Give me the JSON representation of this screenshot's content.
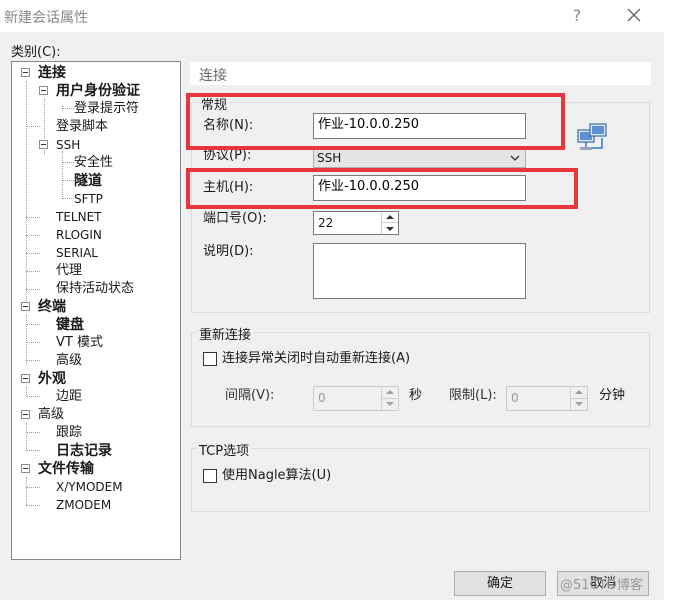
{
  "window": {
    "title": "新建会话属性",
    "help": "?"
  },
  "sidebar": {
    "category_label": "类别(C):",
    "items": [
      {
        "label": "连接"
      },
      {
        "label": "用户身份验证"
      },
      {
        "label": "登录提示符"
      },
      {
        "label": "登录脚本"
      },
      {
        "label": "SSH"
      },
      {
        "label": "安全性"
      },
      {
        "label": "隧道"
      },
      {
        "label": "SFTP"
      },
      {
        "label": "TELNET"
      },
      {
        "label": "RLOGIN"
      },
      {
        "label": "SERIAL"
      },
      {
        "label": "代理"
      },
      {
        "label": "保持活动状态"
      },
      {
        "label": "终端"
      },
      {
        "label": "键盘"
      },
      {
        "label": "VT 模式"
      },
      {
        "label": "高级"
      },
      {
        "label": "外观"
      },
      {
        "label": "边距"
      },
      {
        "label": "高级"
      },
      {
        "label": "跟踪"
      },
      {
        "label": "日志记录"
      },
      {
        "label": "文件传输"
      },
      {
        "label": "X/YMODEM"
      },
      {
        "label": "ZMODEM"
      }
    ]
  },
  "main": {
    "section_title": "连接",
    "general": {
      "group_label": "常规",
      "name_label": "名称(N):",
      "name_value": "作业-10.0.0.250",
      "protocol_label": "协议(P):",
      "protocol_value": "SSH",
      "host_label": "主机(H):",
      "host_value": "作业-10.0.0.250",
      "port_label": "端口号(O):",
      "port_value": "22",
      "desc_label": "说明(D):",
      "desc_value": ""
    },
    "reconnect": {
      "group_label": "重新连接",
      "checkbox_label": "连接异常关闭时自动重新连接(A)",
      "interval_label": "间隔(V):",
      "interval_value": "0",
      "seconds_label": "秒",
      "limit_label": "限制(L):",
      "limit_value": "0",
      "minutes_label": "分钟"
    },
    "tcp": {
      "group_label": "TCP选项",
      "checkbox_label": "使用Nagle算法(U)"
    }
  },
  "footer": {
    "ok_label": "确定",
    "cancel_label": "取消"
  },
  "watermark": "@51CTO博客",
  "colors": {
    "highlight": "#e8363c",
    "dialog_bg": "#f0f0f0"
  }
}
